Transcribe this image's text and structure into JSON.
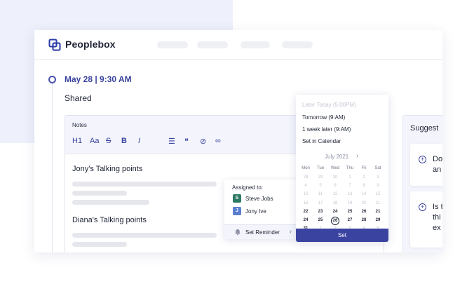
{
  "app": {
    "brand": "Peoplebox"
  },
  "entry": {
    "date": "May 28 | 9:30 AM",
    "status": "Shared"
  },
  "notes": {
    "label": "Notes",
    "toolbar": [
      {
        "name": "heading-icon",
        "glyph": "H1"
      },
      {
        "name": "font-size-icon",
        "glyph": "Aa"
      },
      {
        "name": "strikethrough-icon",
        "glyph": "S"
      },
      {
        "name": "bold-icon",
        "glyph": "B"
      },
      {
        "name": "italic-icon",
        "glyph": "I"
      },
      {
        "name": "bullet-list-icon",
        "glyph": "☰"
      },
      {
        "name": "quote-icon",
        "glyph": "❝"
      },
      {
        "name": "attachment-icon",
        "glyph": "⊘"
      },
      {
        "name": "link-icon",
        "glyph": "∞"
      }
    ],
    "section1": "Jony's Talking points",
    "section2": "Diana's Talking points"
  },
  "assign": {
    "label": "Assigned to:",
    "people": [
      {
        "initial": "S",
        "name": "Steve Jobs",
        "color": "#2c7a64"
      },
      {
        "initial": "J",
        "name": "Jony Ive",
        "color": "#5b7fd1"
      }
    ],
    "reminder_label": "Set Reminder"
  },
  "datepicker": {
    "options": [
      "Later Today (5:00PM)",
      "Tomorrow (9:AM)",
      "1 week later (9:AM)",
      "Set in Calendar"
    ],
    "month": "July 2021",
    "weekdays": [
      "Mon",
      "Tue",
      "Wed",
      "Thu",
      "Fri",
      "Sat"
    ],
    "weeks": [
      [
        "28",
        "29",
        "30",
        "1",
        "2",
        "3"
      ],
      [
        "4",
        "5",
        "6",
        "7",
        "8",
        "9"
      ],
      [
        "10",
        "11",
        "12",
        "13",
        "14",
        "15"
      ],
      [
        "16",
        "17",
        "18",
        "19",
        "20",
        "21"
      ],
      [
        "22",
        "23",
        "24",
        "25",
        "26",
        "21"
      ],
      [
        "24",
        "25",
        "26",
        "27",
        "28",
        "29"
      ],
      [
        "31",
        "1",
        "2",
        "3",
        "4",
        "5"
      ]
    ],
    "set_label": "Set"
  },
  "suggest": {
    "title": "Suggest",
    "items": [
      [
        "Do",
        "an"
      ],
      [
        "Is t",
        "thi",
        "ex"
      ]
    ]
  },
  "colors": {
    "accent": "#3a43a0"
  }
}
